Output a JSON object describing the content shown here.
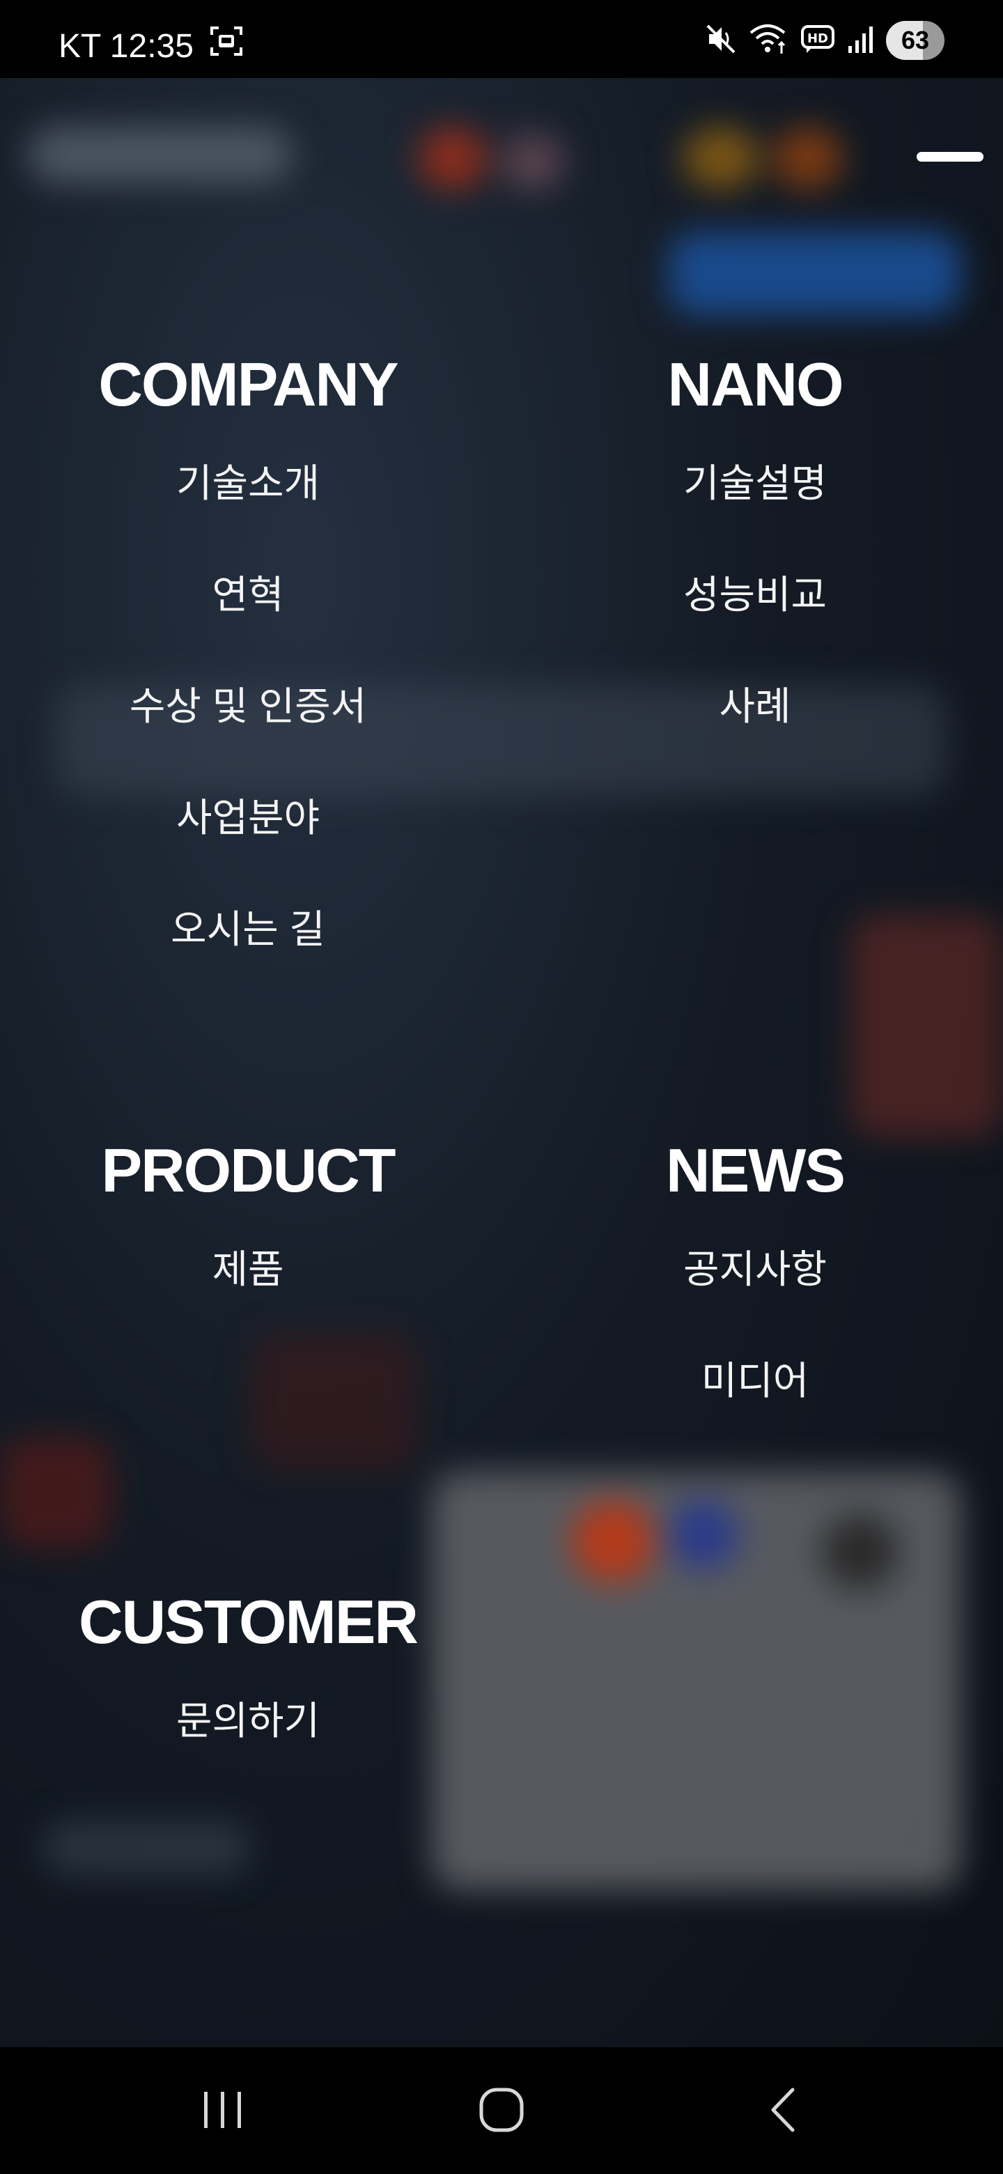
{
  "status_bar": {
    "carrier_time": "KT 12:35",
    "battery": "63"
  },
  "menu": {
    "sections": [
      {
        "title": "COMPANY",
        "items": [
          "기술소개",
          "연혁",
          "수상 및 인증서",
          "사업분야",
          "오시는 길"
        ]
      },
      {
        "title": "NANO",
        "items": [
          "기술설명",
          "성능비교",
          "사례"
        ]
      },
      {
        "title": "PRODUCT",
        "items": [
          "제품"
        ]
      },
      {
        "title": "NEWS",
        "items": [
          "공지사항",
          "미디어"
        ]
      },
      {
        "title": "CUSTOMER",
        "items": [
          "문의하기"
        ]
      }
    ]
  },
  "icons": {
    "status_left": [
      "screenshot-icon"
    ],
    "status_right": [
      "mute-icon",
      "wifi-icon",
      "hd-voice-icon",
      "signal-icon",
      "battery-icon"
    ],
    "nav": [
      "recent-apps-icon",
      "home-icon",
      "back-icon"
    ],
    "menu": "menu-close-icon"
  }
}
